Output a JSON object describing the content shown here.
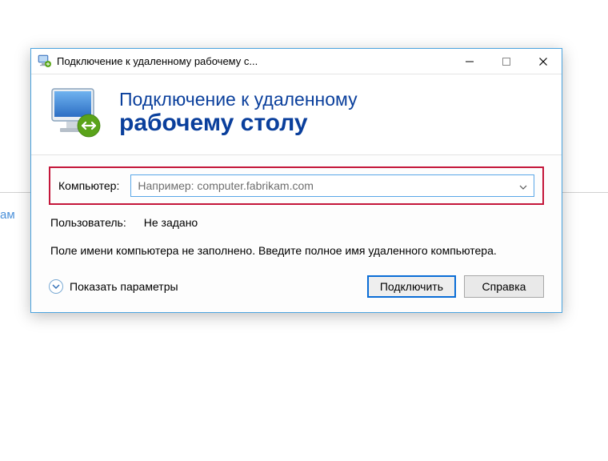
{
  "background": {
    "partial_text": "ам"
  },
  "window": {
    "title": "Подключение к удаленному рабочему с..."
  },
  "banner": {
    "line1": "Подключение к удаленному",
    "line2": "рабочему столу"
  },
  "fields": {
    "computer_label": "Компьютер:",
    "computer_placeholder": "Например: computer.fabrikam.com",
    "user_label": "Пользователь:",
    "user_value": "Не задано"
  },
  "info": {
    "message": "Поле имени компьютера не заполнено. Введите полное имя удаленного компьютера."
  },
  "footer": {
    "expand_label": "Показать параметры",
    "connect_label": "Подключить",
    "help_label": "Справка"
  }
}
